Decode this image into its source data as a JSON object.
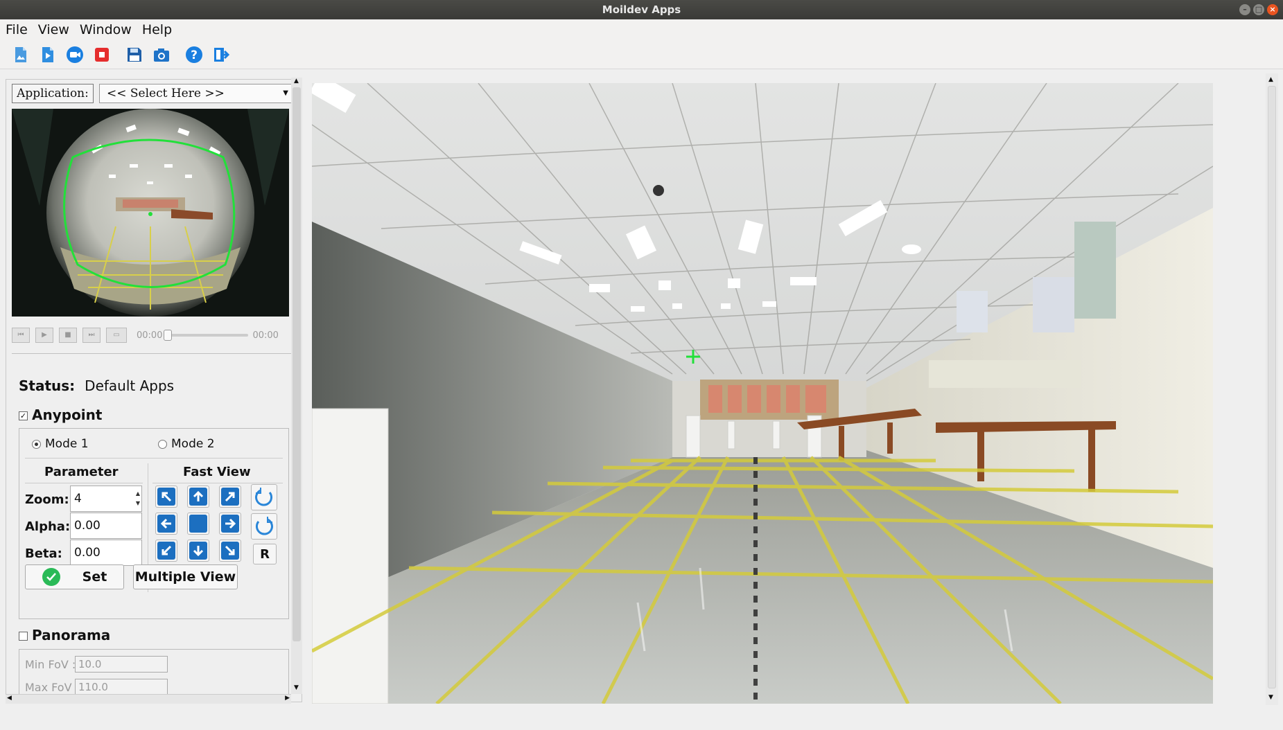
{
  "window": {
    "title": "Moildev Apps",
    "close_glyph": "×"
  },
  "menu": [
    "File",
    "View",
    "Window",
    "Help"
  ],
  "toolbar_icons": [
    "open-image-icon",
    "open-video-icon",
    "camera-record-icon",
    "stop-icon",
    "save-icon",
    "snapshot-camera-icon",
    "help-icon",
    "exit-icon"
  ],
  "application": {
    "label": "Application:",
    "selected": "<< Select Here >>"
  },
  "media": {
    "time_start": "00:00",
    "time_end": "00:00",
    "progress": 0
  },
  "status": {
    "label": "Status:",
    "value": "Default Apps"
  },
  "anypoint": {
    "label": "Anypoint",
    "checked": true,
    "mode1": "Mode 1",
    "mode2": "Mode 2",
    "selected_mode": 1,
    "parameter_header": "Parameter",
    "fastview_header": "Fast View",
    "zoom_label": "Zoom:",
    "zoom_value": "4",
    "alpha_label": "Alpha:",
    "alpha_value": "0.00",
    "beta_label": "Beta:",
    "beta_value": "0.00",
    "reset_label": "R",
    "set_label": "Set",
    "multiple_view_label": "Multiple View"
  },
  "panorama": {
    "label": "Panorama",
    "checked": false,
    "min_fov_label": "Min FoV :",
    "min_fov_value": "10.0",
    "max_fov_label": "Max FoV :",
    "max_fov_value": "110.0"
  },
  "colors": {
    "accent": "#1c6fc0",
    "set_ok": "#2aba57",
    "overlay_green": "#22e03a",
    "titlebar": "#3c3b37"
  }
}
